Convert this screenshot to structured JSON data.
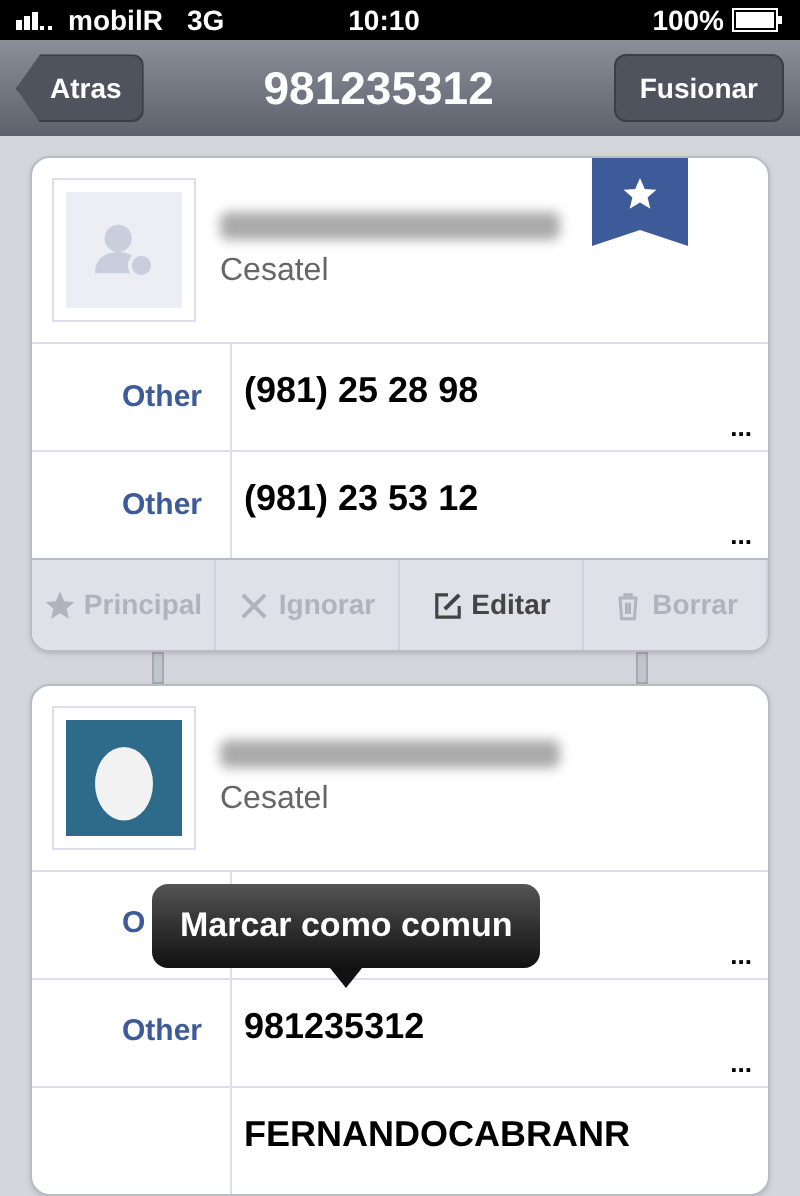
{
  "status_bar": {
    "carrier": "mobilR",
    "network": "3G",
    "time": "10:10",
    "battery": "100%"
  },
  "nav": {
    "back": "Atras",
    "title": "981235312",
    "action": "Fusionar"
  },
  "contacts": [
    {
      "avatar": {
        "kind": "placeholder"
      },
      "company": "Cesatel",
      "starred": true,
      "rows": [
        {
          "label": "Other",
          "value": "(981) 25 28 98",
          "more": "..."
        },
        {
          "label": "Other",
          "value": "(981) 23 53 12",
          "more": "..."
        }
      ],
      "actions": [
        {
          "kind": "star",
          "label": "Principal",
          "disabled": true
        },
        {
          "kind": "close",
          "label": "Ignorar",
          "disabled": true
        },
        {
          "kind": "edit",
          "label": "Editar",
          "disabled": false
        },
        {
          "kind": "trash",
          "label": "Borrar",
          "disabled": true
        }
      ]
    },
    {
      "avatar": {
        "kind": "egg"
      },
      "company": "Cesatel",
      "starred": false,
      "rows": [
        {
          "label": "O",
          "value": "",
          "more": "..."
        },
        {
          "label": "Other",
          "value": "981235312",
          "more": "..."
        },
        {
          "label": "",
          "value": "FERNANDOCABRANR",
          "more": ""
        }
      ]
    }
  ],
  "tooltip": {
    "text": "Marcar como comun"
  }
}
